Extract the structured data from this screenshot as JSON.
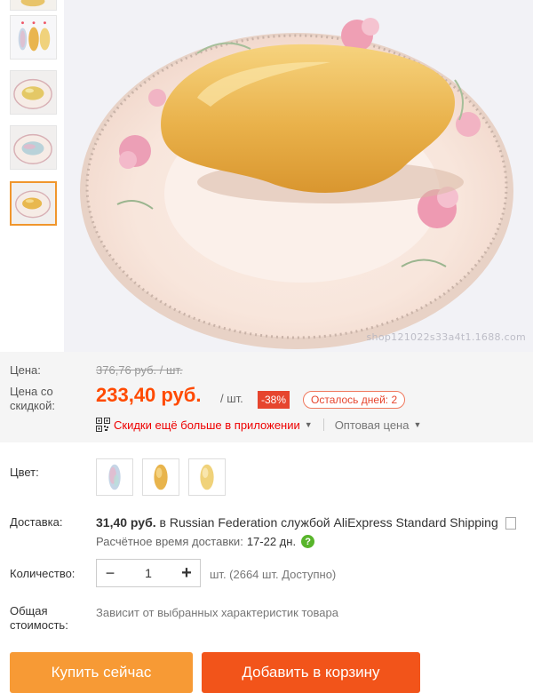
{
  "gallery": {
    "watermark": "shop121022s33a4t1.1688.com"
  },
  "price": {
    "price_label": "Цена:",
    "original": "376,76 руб. / шт.",
    "discount_label": "Цена со скидкой:",
    "discounted": "233,40 руб.",
    "per_unit": "/ шт.",
    "discount_pct": "-38%",
    "days_left": "Осталось дней: 2",
    "app_deal": "Скидки ещё больше в приложении",
    "wholesale": "Оптовая цена",
    "accent_color": "#ff4a00",
    "badge_color": "#e6452e"
  },
  "color": {
    "label": "Цвет:",
    "options": [
      "iridescent",
      "gold",
      "light-gold"
    ]
  },
  "shipping": {
    "label": "Доставка:",
    "cost": "31,40 руб.",
    "to_word": "в",
    "country": "Russian Federation",
    "by_word": "службой",
    "service": "AliExpress Standard Shipping",
    "eta_label": "Расчётное время доставки:",
    "eta_days": "17-22 дн."
  },
  "quantity": {
    "label": "Количество:",
    "minus": "−",
    "value": "1",
    "plus": "+",
    "available": "шт. (2664 шт. Доступно)"
  },
  "total": {
    "label": "Общая стоимость:",
    "note": "Зависит от выбранных характеристик товара"
  },
  "actions": {
    "buy_now": "Купить сейчас",
    "add_to_cart": "Добавить в корзину"
  }
}
